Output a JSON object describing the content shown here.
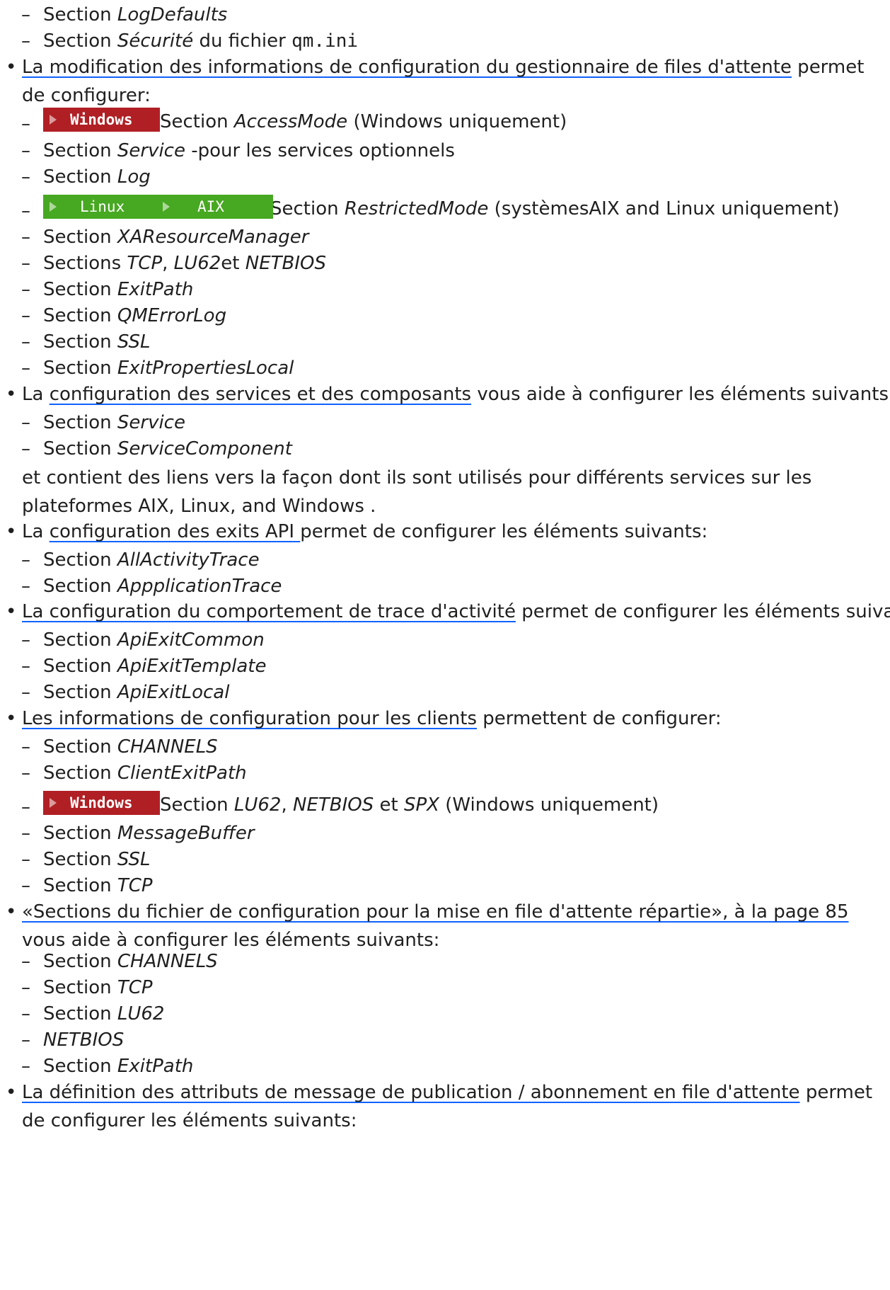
{
  "bullet": "•",
  "dash": "–",
  "section_word": "Section",
  "sections_word": "Sections",
  "labels": {
    "windows": "Windows",
    "linux": "Linux",
    "aix": "AIX"
  },
  "colors": {
    "windows_tag": "#b01f24",
    "unix_tag": "#47a821",
    "link_underline": "#0f62fe"
  },
  "top": {
    "item1_name": "LogDefaults",
    "item2_name": "Sécurité",
    "item2_mid": " du fichier ",
    "item2_file": "qm.ini"
  },
  "qm": {
    "link": "La modification des informations de configuration du gestionnaire de files d'attente",
    "after": " permet de configurer:",
    "accessmode_name": "AccessMode",
    "accessmode_suffix": " (Windows uniquement)",
    "service_name": "Service",
    "service_suffix": " -pour les services optionnels",
    "log_name": "Log",
    "restricted_name": "RestrictedMode",
    "restricted_suffix": " (systèmesAIX and Linux uniquement)",
    "xa_name": "XAResourceManager",
    "tcp_name": "TCP",
    "sep": ", ",
    "lu62_name": "LU62",
    "et": "et ",
    "netbios_name": "NETBIOS",
    "exitpath_name": "ExitPath",
    "qmerror_name": "QMErrorLog",
    "ssl_name": "SSL",
    "exitprops_name": "ExitPropertiesLocal"
  },
  "svc": {
    "pre": "La ",
    "link": "configuration des services et des composants",
    "after": " vous aide à configurer les éléments suivants:",
    "item1": "Service",
    "item2": "ServiceComponent",
    "para": "et contient des liens vers la façon dont ils sont utilisés pour différents services sur les plateformes AIX, Linux, and Windows ."
  },
  "api": {
    "pre": "La ",
    "link": "configuration des exits API ",
    "after": "permet de configurer les éléments suivants:",
    "item1": "AllActivityTrace",
    "item2": "AppplicationTrace"
  },
  "trace": {
    "link": "La configuration du comportement de trace d'activité",
    "after": " permet de configurer les éléments suivants:",
    "item1": "ApiExitCommon",
    "item2": "ApiExitTemplate",
    "item3": "ApiExitLocal"
  },
  "clients": {
    "link": "Les informations de configuration pour les clients",
    "after": " permettent de configurer:",
    "channels": "CHANNELS",
    "clientexit": "ClientExitPath",
    "lu62": "LU62",
    "sep": ", ",
    "netbios": "NETBIOS",
    "et": " et ",
    "spx": "SPX",
    "suffix": " (Windows uniquement)",
    "msgbuf": "MessageBuffer",
    "ssl": "SSL",
    "tcp": "TCP"
  },
  "distrib": {
    "link": "«Sections du fichier de configuration pour la mise en file d'attente répartie», à la page 85",
    "after": " vous aide à configurer les éléments suivants:",
    "channels": "CHANNELS",
    "tcp": "TCP",
    "lu62": "LU62",
    "netbios": "NETBIOS",
    "exitpath": "ExitPath"
  },
  "pubsub": {
    "link": "La définition des attributs de message de publication / abonnement en file d'attente",
    "after": " permet de configurer les éléments suivants:"
  }
}
